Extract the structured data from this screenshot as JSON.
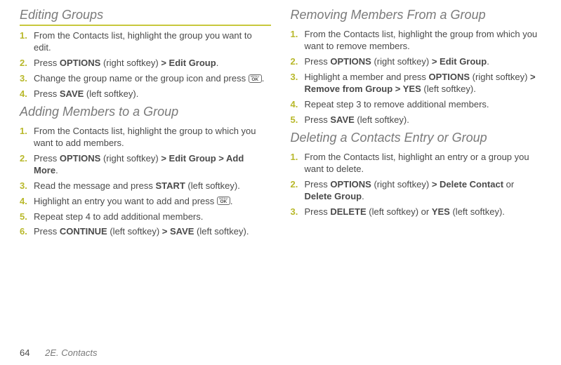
{
  "left": {
    "section1": {
      "title": "Editing Groups",
      "steps": [
        {
          "n": "1.",
          "html": "From the Contacts list, highlight the group you want to edit."
        },
        {
          "n": "2.",
          "html": "Press <b>OPTIONS</b> (right softkey) <b>> Edit Group</b>."
        },
        {
          "n": "3.",
          "html": "Change the group name or the group icon and press {{OK}}."
        },
        {
          "n": "4.",
          "html": "Press <b>SAVE</b> (left softkey)."
        }
      ]
    },
    "section2": {
      "title": "Adding Members to a Group",
      "steps": [
        {
          "n": "1.",
          "html": "From the Contacts list, highlight the group to which you want to add members."
        },
        {
          "n": "2.",
          "html": "Press <b>OPTIONS</b> (right softkey) <b>> Edit Group > Add More</b>."
        },
        {
          "n": "3.",
          "html": "Read the message and press <b>START</b> (left softkey)."
        },
        {
          "n": "4.",
          "html": "Highlight an entry you want to add and press {{OK}}."
        },
        {
          "n": "5.",
          "html": "Repeat step 4 to add additional members."
        },
        {
          "n": "6.",
          "html": "Press <b>CONTINUE</b> (left softkey) <b>> SAVE</b> (left softkey)."
        }
      ]
    }
  },
  "right": {
    "section1": {
      "title": "Removing Members From a Group",
      "steps": [
        {
          "n": "1.",
          "html": "From the Contacts list, highlight the group from which you want to remove members."
        },
        {
          "n": "2.",
          "html": "Press <b>OPTIONS</b> (right softkey) <b>> Edit Group</b>."
        },
        {
          "n": "3.",
          "html": "Highlight a member and press <b>OPTIONS</b> (right softkey) <b>> Remove from Group > YES</b> (left softkey)."
        },
        {
          "n": "4.",
          "html": "Repeat step 3 to remove additional members."
        },
        {
          "n": "5.",
          "html": "Press <b>SAVE</b> (left softkey)."
        }
      ]
    },
    "section2": {
      "title": "Deleting a Contacts Entry or Group",
      "steps": [
        {
          "n": "1.",
          "html": "From the Contacts list, highlight an entry or a group you want to delete."
        },
        {
          "n": "2.",
          "html": "Press <b>OPTIONS</b> (right softkey) <b>> Delete Contact</b> or <b>Delete Group</b>."
        },
        {
          "n": "3.",
          "html": "Press <b>DELETE</b> (left softkey) or <b>YES</b> (left softkey)."
        }
      ]
    }
  },
  "footer": {
    "page": "64",
    "label": "2E. Contacts"
  },
  "ok_label_top": "MENU",
  "ok_label_bottom": "OK"
}
